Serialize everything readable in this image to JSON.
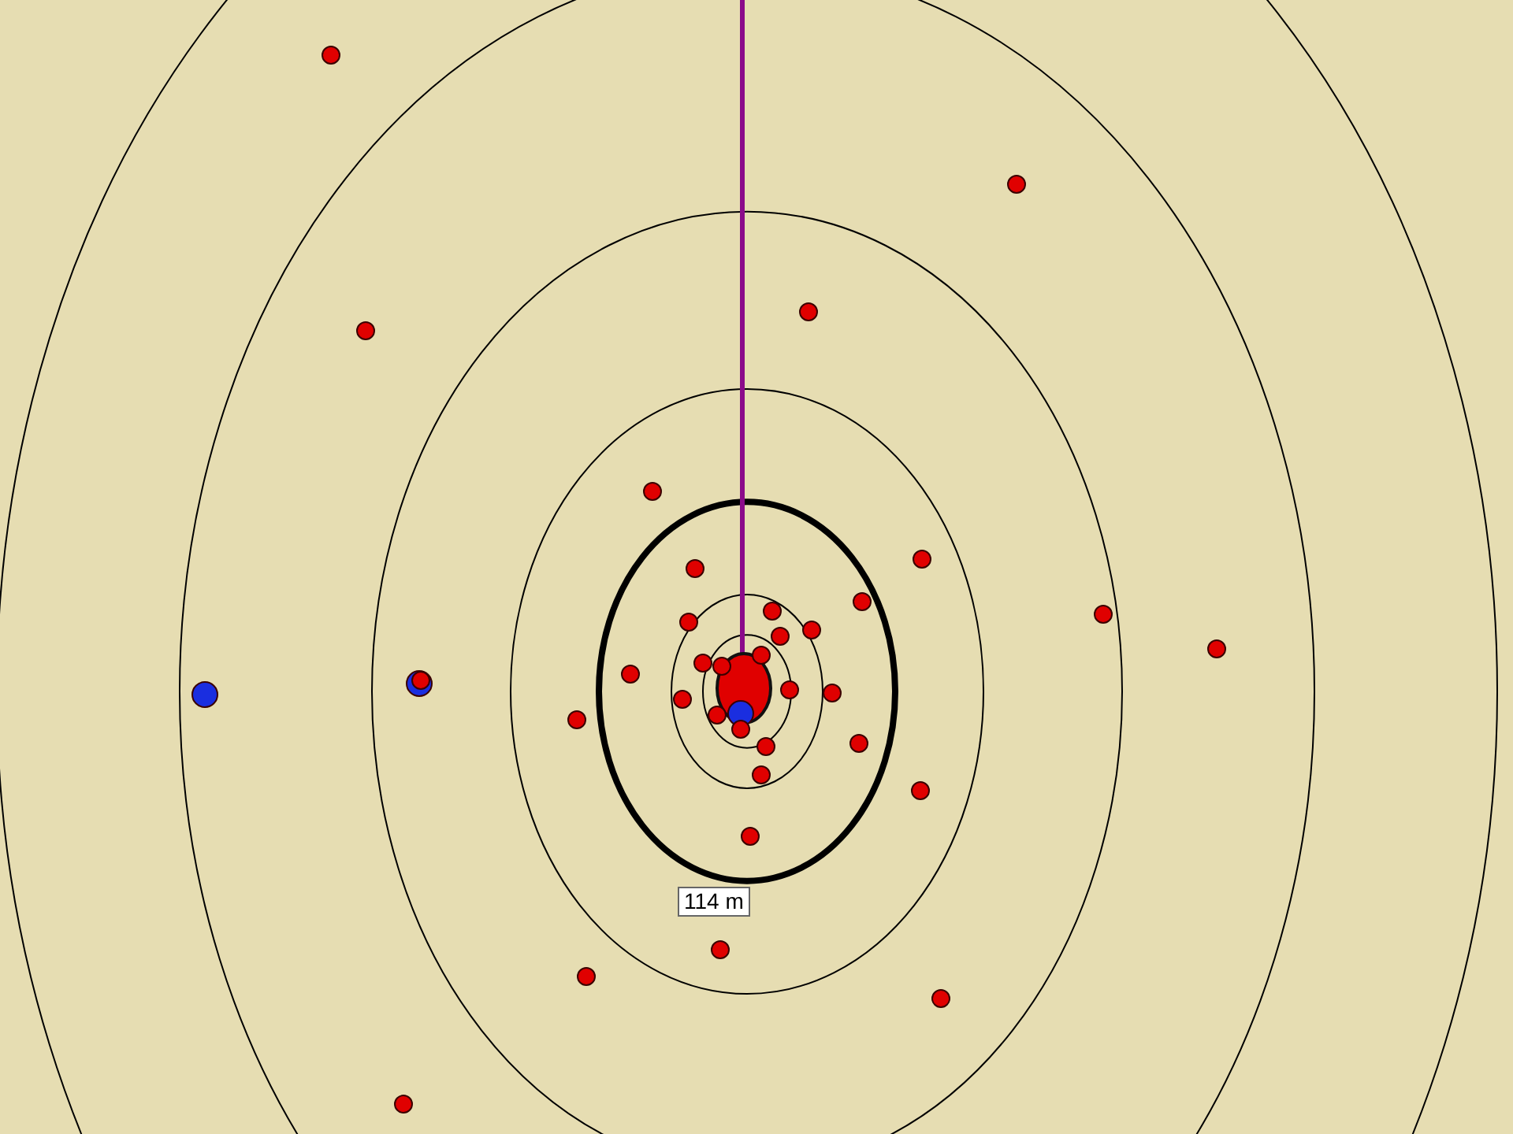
{
  "map": {
    "distance_label": "114 m",
    "markers": [
      {
        "kind": "cluster",
        "color": "#e00000"
      },
      {
        "kind": "dot",
        "color": "#e00000"
      },
      {
        "kind": "dot",
        "color": "#e00000"
      },
      {
        "kind": "dot",
        "color": "#e00000"
      },
      {
        "kind": "dot",
        "color": "#e00000"
      },
      {
        "kind": "dot",
        "color": "#e00000"
      },
      {
        "kind": "dot",
        "color": "#e00000"
      },
      {
        "kind": "dot",
        "color": "#e00000"
      },
      {
        "kind": "dot",
        "color": "#e00000"
      },
      {
        "kind": "dot",
        "color": "#e00000"
      },
      {
        "kind": "dot",
        "color": "#e00000"
      },
      {
        "kind": "dot",
        "color": "#e00000"
      },
      {
        "kind": "dot",
        "color": "#e00000"
      },
      {
        "kind": "dot",
        "color": "#e00000"
      },
      {
        "kind": "dot",
        "color": "#e00000"
      },
      {
        "kind": "dot",
        "color": "#e00000"
      },
      {
        "kind": "dot",
        "color": "#e00000"
      },
      {
        "kind": "dot",
        "color": "#e00000"
      },
      {
        "kind": "dot",
        "color": "#e00000"
      },
      {
        "kind": "dot",
        "color": "#e00000"
      },
      {
        "kind": "dot",
        "color": "#e00000"
      },
      {
        "kind": "dot",
        "color": "#e00000"
      },
      {
        "kind": "dot",
        "color": "#e00000"
      },
      {
        "kind": "dot",
        "color": "#e00000"
      },
      {
        "kind": "dot",
        "color": "#e00000"
      },
      {
        "kind": "dot",
        "color": "#e00000"
      },
      {
        "kind": "dot",
        "color": "#e00000"
      },
      {
        "kind": "dot",
        "color": "#e00000"
      },
      {
        "kind": "dot",
        "color": "#e00000"
      },
      {
        "kind": "dot",
        "color": "#e00000"
      },
      {
        "kind": "dot",
        "color": "#e00000"
      },
      {
        "kind": "dot",
        "color": "#e00000"
      },
      {
        "kind": "dot",
        "color": "#e00000"
      },
      {
        "kind": "dot",
        "color": "#e00000"
      },
      {
        "kind": "dot",
        "color": "#e00000"
      },
      {
        "kind": "dot",
        "color": "#1a2ee0"
      },
      {
        "kind": "dot",
        "color": "#1a2ee0"
      },
      {
        "kind": "dot",
        "color": "#1a2ee0"
      }
    ]
  }
}
